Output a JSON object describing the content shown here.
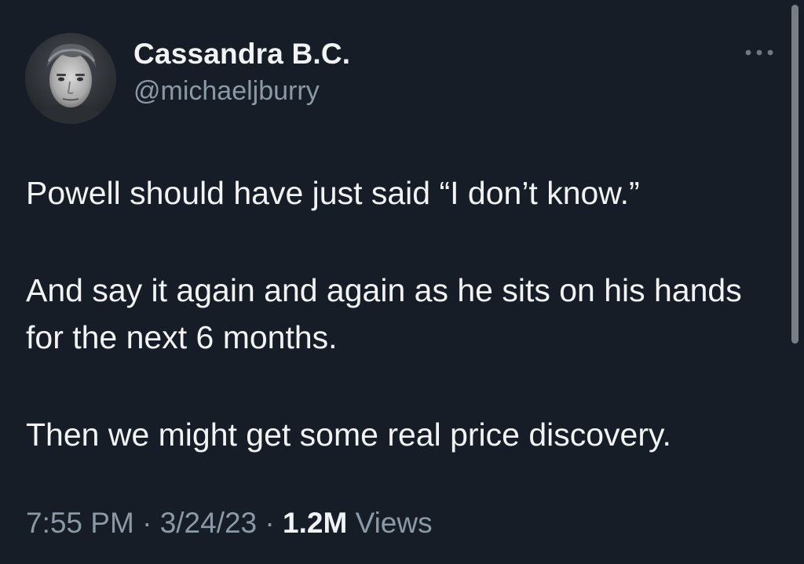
{
  "user": {
    "display_name": "Cassandra B.C.",
    "handle": "@michaeljburry"
  },
  "more_icon": "more-horizontal-icon",
  "tweet": {
    "paragraphs": [
      "Powell should have just said “I don’t know.”",
      "And say it again and again as he sits on his hands for the next 6 months.",
      "Then we might get some real price discovery."
    ]
  },
  "meta": {
    "time": "7:55 PM",
    "separator": " · ",
    "date": "3/24/23",
    "views_count": "1.2M",
    "views_label": "Views"
  },
  "colors": {
    "background": "#161d26",
    "text": "#f1f3f4",
    "secondary_text": "#8b98a5"
  }
}
